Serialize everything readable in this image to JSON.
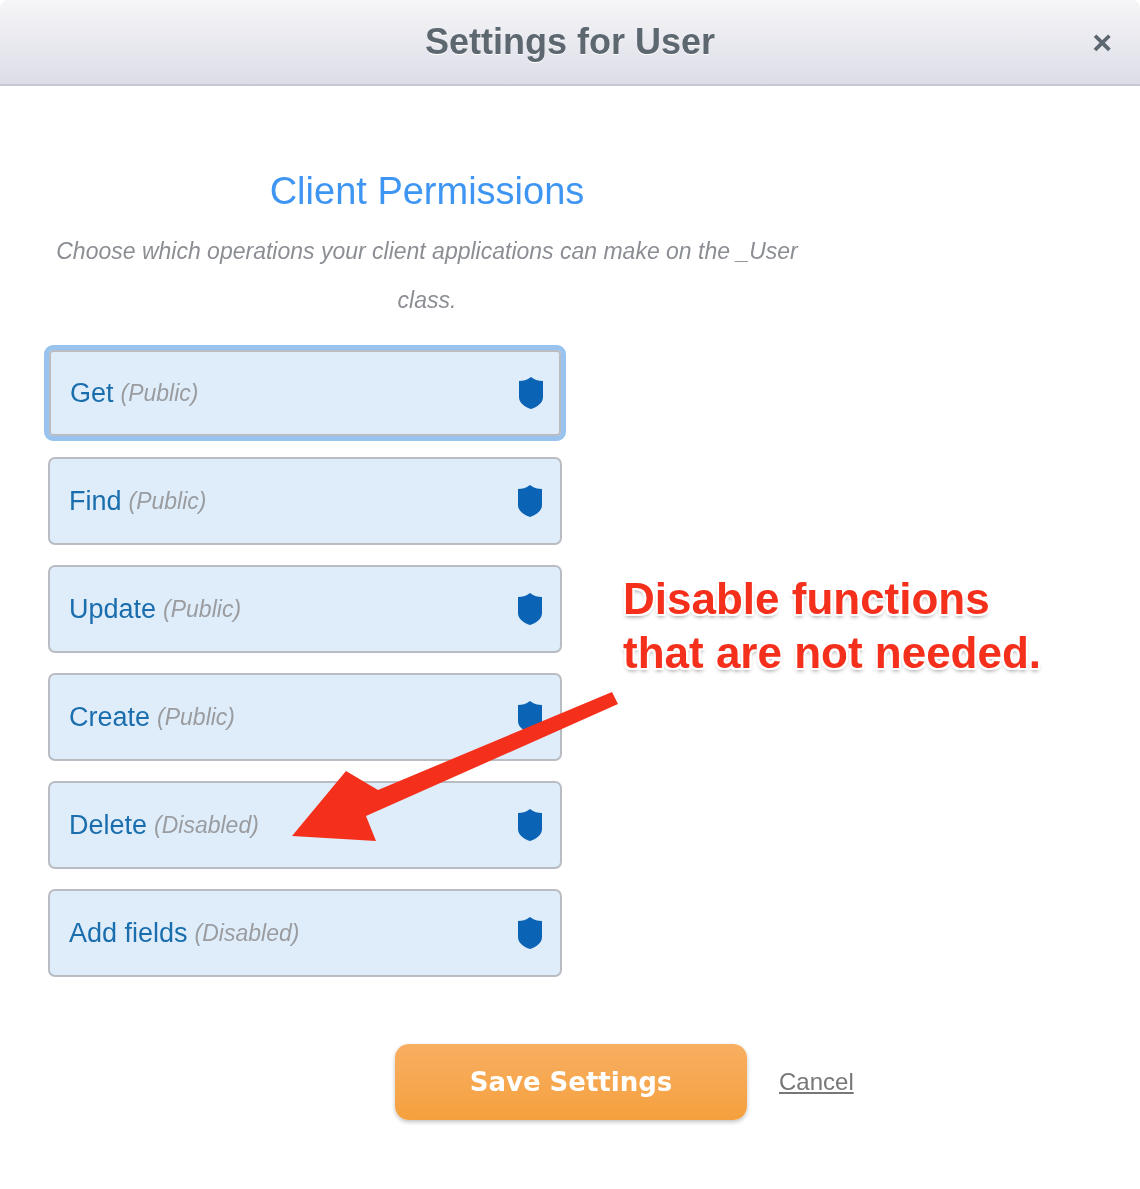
{
  "dialog": {
    "title": "Settings for User",
    "close": "×"
  },
  "section": {
    "title": "Client Permissions",
    "description": "Choose which operations your client applications can make on the _User class."
  },
  "permissions": [
    {
      "name": "Get",
      "access": "(Public)",
      "selected": true
    },
    {
      "name": "Find",
      "access": "(Public)",
      "selected": false
    },
    {
      "name": "Update",
      "access": "(Public)",
      "selected": false
    },
    {
      "name": "Create",
      "access": "(Public)",
      "selected": false
    },
    {
      "name": "Delete",
      "access": "(Disabled)",
      "selected": false
    },
    {
      "name": "Add fields",
      "access": "(Disabled)",
      "selected": false
    }
  ],
  "annotation": {
    "lines": [
      "Disable functions",
      "that are not needed."
    ]
  },
  "buttons": {
    "save": "Save Settings",
    "cancel": "Cancel"
  }
}
